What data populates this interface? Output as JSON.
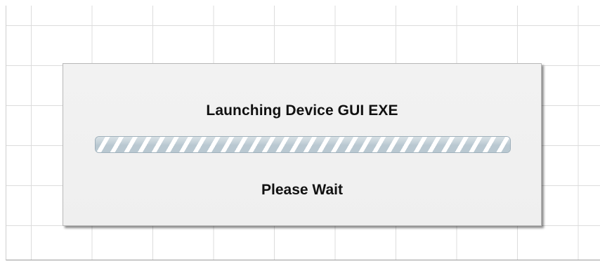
{
  "dialog": {
    "title": "Launching Device GUI EXE",
    "status_text": "Please Wait",
    "progress": {
      "indeterminate": true,
      "fraction": 1.0
    }
  },
  "colors": {
    "background": "#ffffff",
    "grid_line": "#dcdcdc",
    "dialog_bg": "#f0f0f0",
    "text": "#111111",
    "progress_stripe_dark": "#b9c8d1",
    "progress_stripe_light": "#ffffff",
    "progress_border": "#9fb0bb"
  }
}
